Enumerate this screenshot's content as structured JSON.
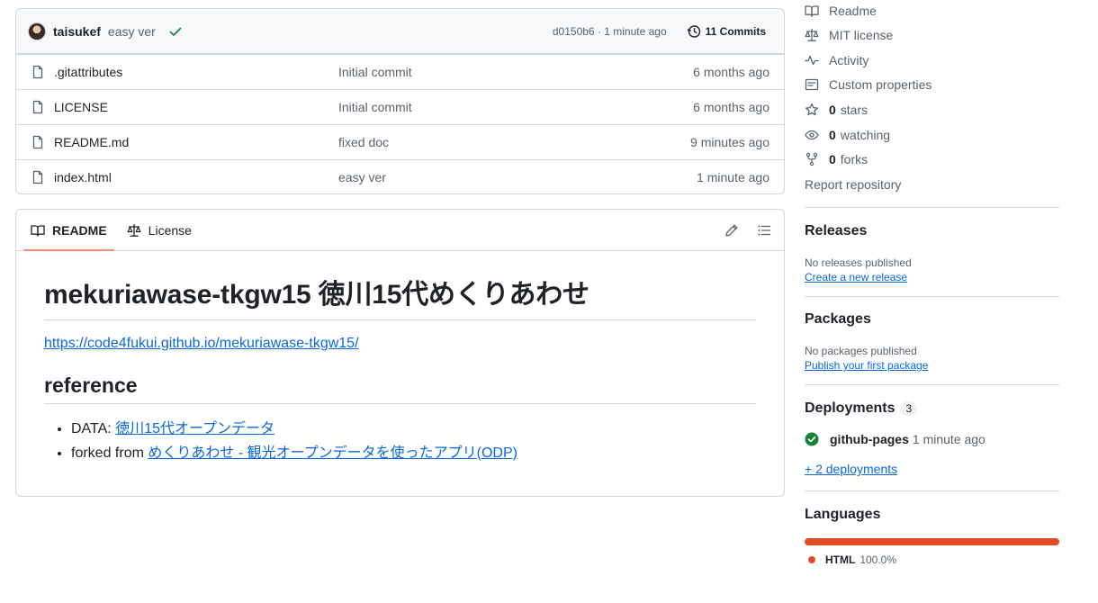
{
  "commit_bar": {
    "author": "taisukef",
    "message": "easy ver",
    "sha_time": "d0150b6 · 1 minute ago",
    "commits_label": "11 Commits"
  },
  "files": [
    {
      "name": ".gitattributes",
      "commit": "Initial commit",
      "time": "6 months ago"
    },
    {
      "name": "LICENSE",
      "commit": "Initial commit",
      "time": "6 months ago"
    },
    {
      "name": "README.md",
      "commit": "fixed doc",
      "time": "9 minutes ago"
    },
    {
      "name": "index.html",
      "commit": "easy ver",
      "time": "1 minute ago"
    }
  ],
  "readme": {
    "tabs": [
      {
        "label": "README"
      },
      {
        "label": "License"
      }
    ],
    "title": "mekuriawase-tkgw15 徳川15代めくりあわせ",
    "link": "https://code4fukui.github.io/mekuriawase-tkgw15/",
    "h2": "reference",
    "items": [
      {
        "prefix": "DATA: ",
        "link": "徳川15代オープンデータ"
      },
      {
        "prefix": "forked from ",
        "link": "めくりあわせ - 観光オープンデータを使ったアプリ(ODP)"
      }
    ]
  },
  "sidebar": {
    "links": [
      {
        "label": "Readme",
        "icon": "book-icon"
      },
      {
        "label": "MIT license",
        "icon": "law-icon"
      },
      {
        "label": "Activity",
        "icon": "pulse-icon"
      },
      {
        "label": "Custom properties",
        "icon": "note-icon"
      },
      {
        "count": "0",
        "label": "stars",
        "icon": "star-icon"
      },
      {
        "count": "0",
        "label": "watching",
        "icon": "eye-icon"
      },
      {
        "count": "0",
        "label": "forks",
        "icon": "fork-icon"
      }
    ],
    "report": "Report repository",
    "releases": {
      "title": "Releases",
      "note": "No releases published",
      "link": "Create a new release"
    },
    "packages": {
      "title": "Packages",
      "note": "No packages published",
      "link": "Publish your first package"
    },
    "deployments": {
      "title": "Deployments",
      "count": "3",
      "env": "github-pages",
      "time": "1 minute ago",
      "more": "+ 2 deployments"
    },
    "languages": {
      "title": "Languages",
      "name": "HTML",
      "percent": "100.0%",
      "color": "#e34c26"
    }
  },
  "colors": {
    "accent": "#0969da",
    "tab_underline": "#fd8c73",
    "success": "#1a7f37"
  }
}
